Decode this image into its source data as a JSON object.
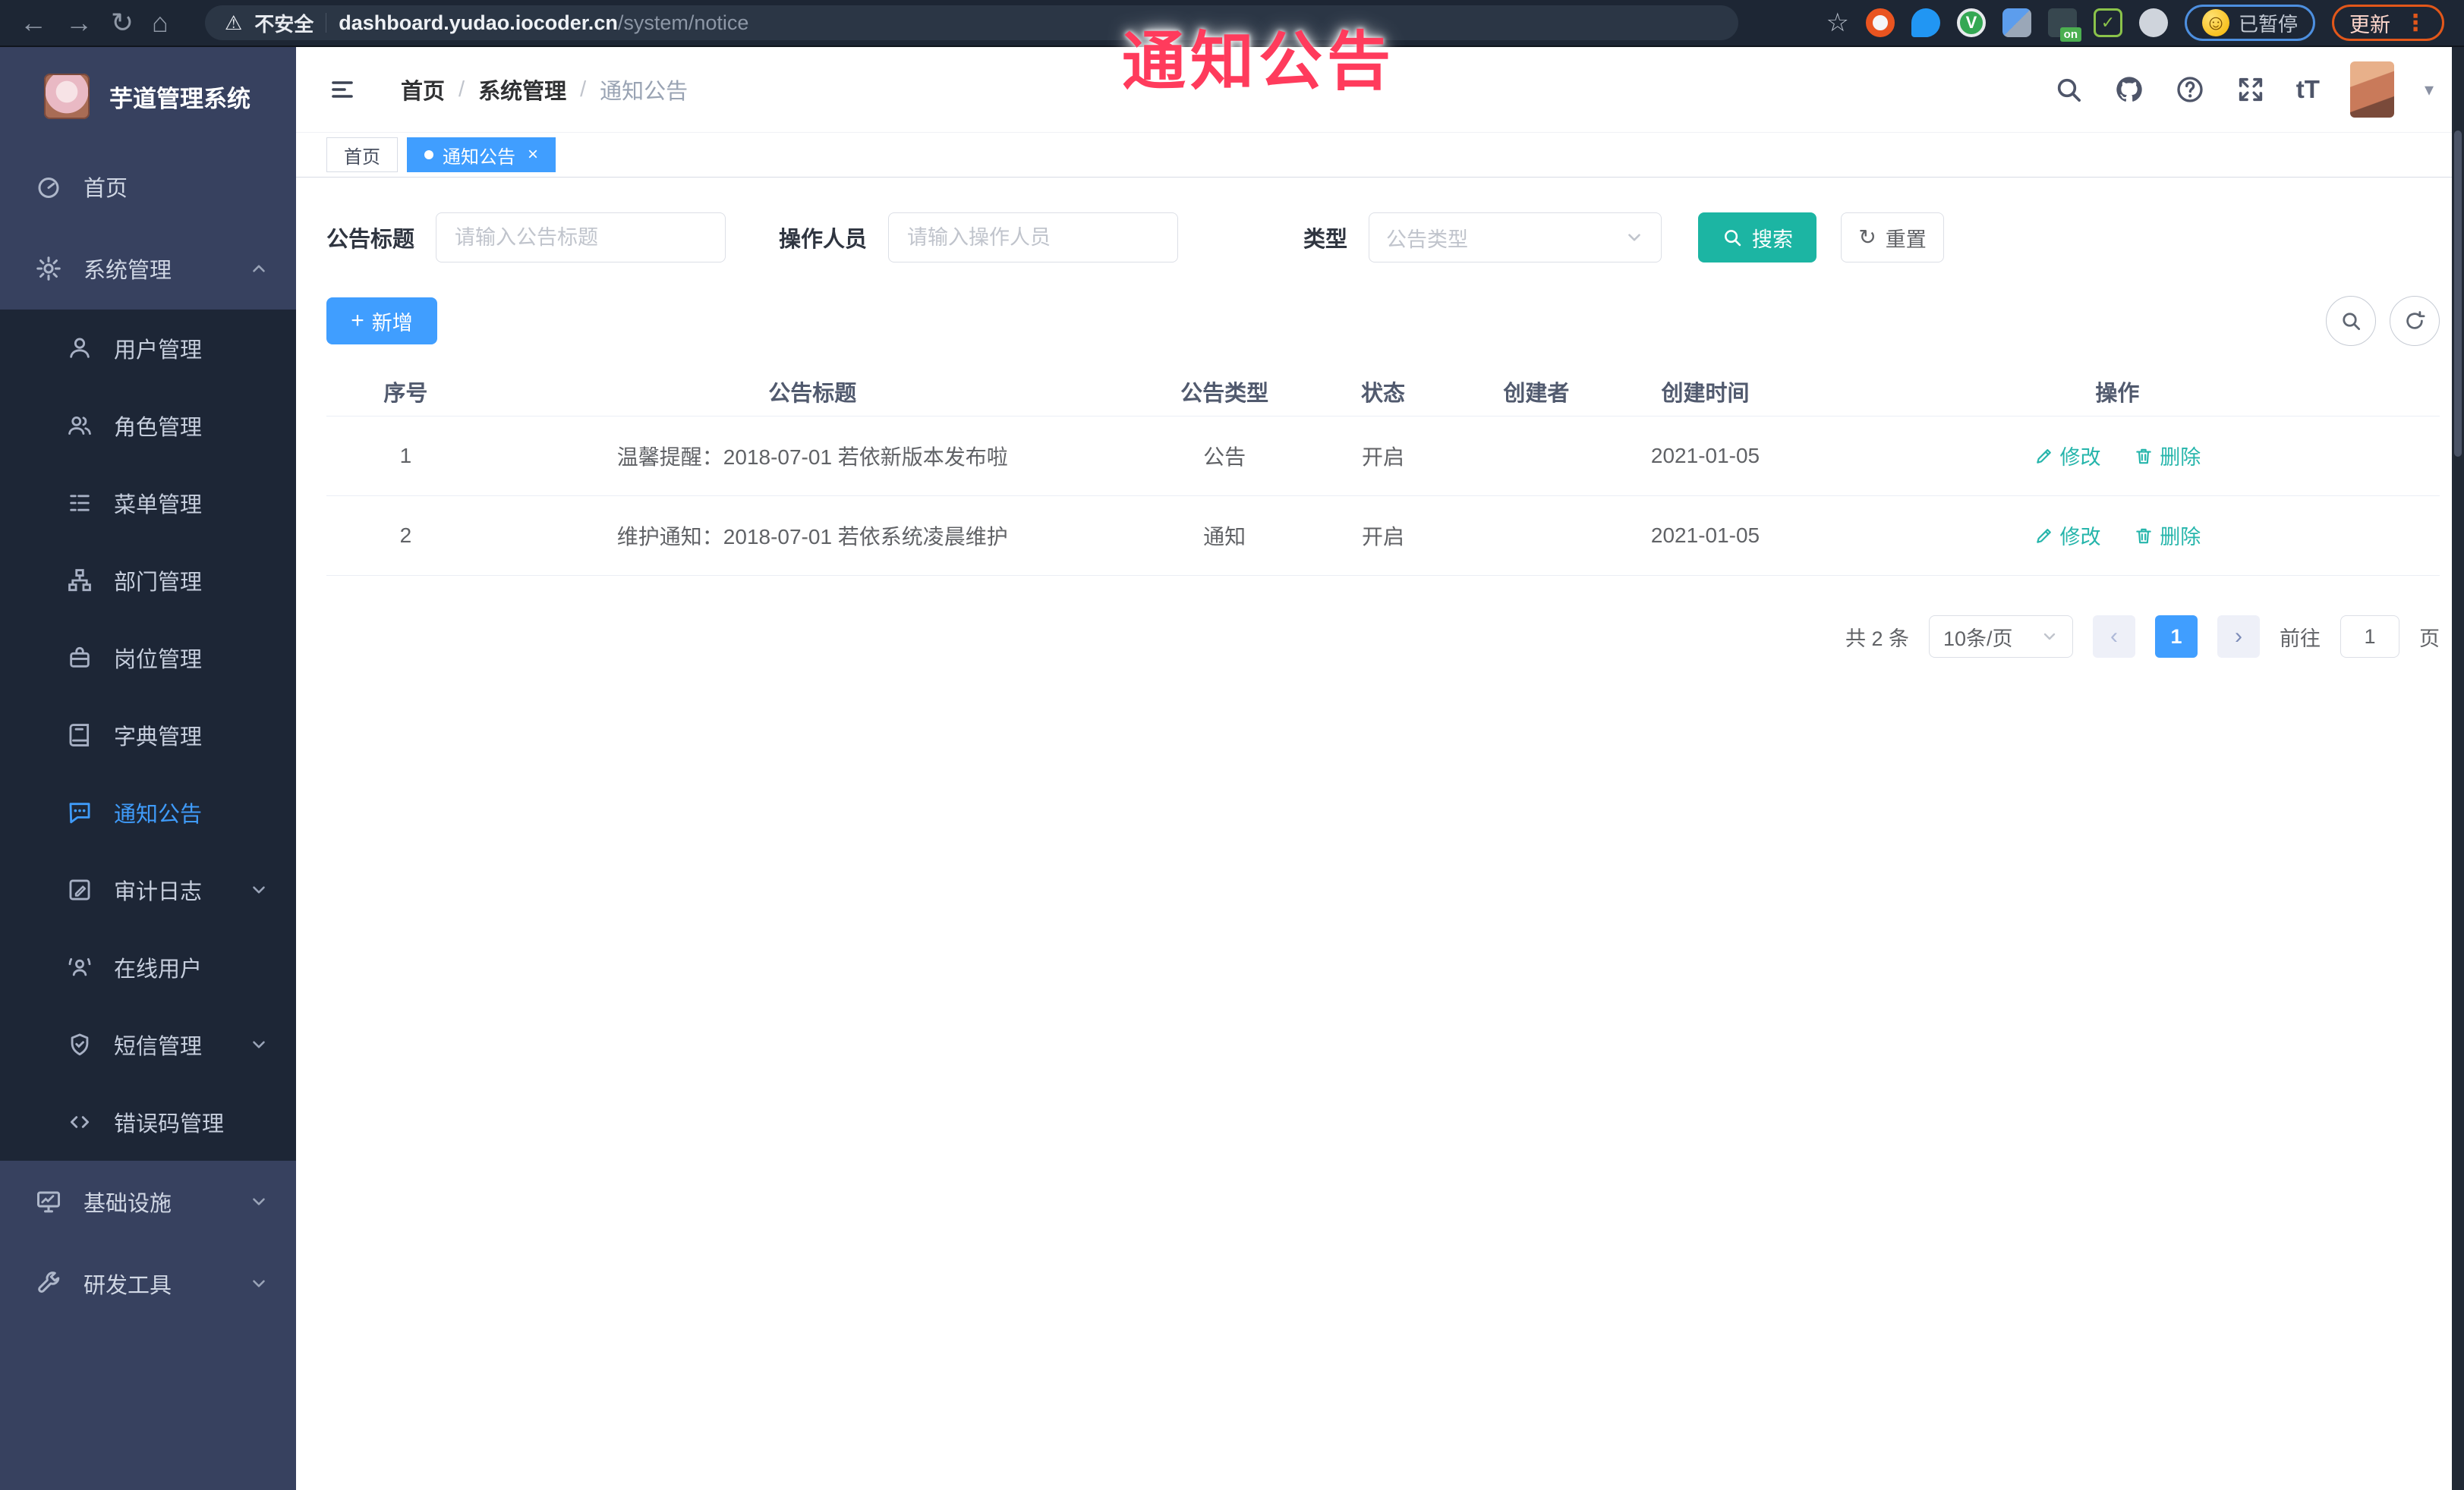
{
  "watermark": {
    "text": "通知公告",
    "color": "#ff3b5c"
  },
  "browser": {
    "security_label": "不安全",
    "url_host": "dashboard.yudao.iocoder.cn",
    "url_path": "/system/notice",
    "extension_badge": "on",
    "profile_status": "已暂停",
    "update_label": "更新",
    "nav_icons": [
      "back-arrow-icon",
      "forward-arrow-icon",
      "reload-icon",
      "home-icon"
    ],
    "extension_icons": [
      "bookmark-star-icon",
      "ubuntu-icon",
      "location-pin-icon",
      "green-v-icon",
      "gem-icon",
      "dark-extension-on-icon",
      "sprout-icon",
      "extensions-puzzle-icon"
    ]
  },
  "sidebar": {
    "app_title": "芋道管理系统",
    "items": [
      {
        "label": "首页",
        "icon": "dashboard-icon"
      },
      {
        "label": "系统管理",
        "icon": "gear-icon",
        "expanded": true
      },
      {
        "label": "用户管理",
        "icon": "user-icon"
      },
      {
        "label": "角色管理",
        "icon": "users-icon"
      },
      {
        "label": "菜单管理",
        "icon": "menu-list-icon"
      },
      {
        "label": "部门管理",
        "icon": "org-tree-icon"
      },
      {
        "label": "岗位管理",
        "icon": "briefcase-icon"
      },
      {
        "label": "字典管理",
        "icon": "book-icon"
      },
      {
        "label": "通知公告",
        "icon": "chat-bubble-icon",
        "active": true
      },
      {
        "label": "审计日志",
        "icon": "edit-square-icon",
        "collapsible": true
      },
      {
        "label": "在线用户",
        "icon": "online-user-icon"
      },
      {
        "label": "短信管理",
        "icon": "shield-check-icon",
        "collapsible": true
      },
      {
        "label": "错误码管理",
        "icon": "code-icon"
      },
      {
        "label": "基础设施",
        "icon": "monitor-chart-icon",
        "collapsible": true
      },
      {
        "label": "研发工具",
        "icon": "wrench-icon",
        "collapsible": true
      }
    ]
  },
  "header": {
    "breadcrumb": [
      "首页",
      "系统管理",
      "通知公告"
    ],
    "icons": [
      "search-icon",
      "github-icon",
      "help-icon",
      "fullscreen-icon",
      "font-size-icon",
      "avatar",
      "caret-down-icon"
    ]
  },
  "tabs": [
    {
      "label": "首页",
      "active": false
    },
    {
      "label": "通知公告",
      "active": true
    }
  ],
  "filters": {
    "title_label": "公告标题",
    "title_placeholder": "请输入公告标题",
    "operator_label": "操作人员",
    "operator_placeholder": "请输入操作人员",
    "type_label": "类型",
    "type_placeholder": "公告类型",
    "search_label": "搜索",
    "reset_label": "重置"
  },
  "toolbar": {
    "add_label": "新增"
  },
  "table": {
    "columns": [
      "序号",
      "公告标题",
      "公告类型",
      "状态",
      "创建者",
      "创建时间",
      "操作"
    ],
    "rows": [
      {
        "seq": "1",
        "title": "温馨提醒：2018-07-01 若依新版本发布啦",
        "type": "公告",
        "status": "开启",
        "creator": "",
        "created_at": "2021-01-05",
        "edit_label": "修改",
        "delete_label": "删除"
      },
      {
        "seq": "2",
        "title": "维护通知：2018-07-01 若依系统凌晨维护",
        "type": "通知",
        "status": "开启",
        "creator": "",
        "created_at": "2021-01-05",
        "edit_label": "修改",
        "delete_label": "删除"
      }
    ]
  },
  "pagination": {
    "total": "共 2 条",
    "page_size": "10条/页",
    "page": "1",
    "goto": "前往",
    "goto_value": "1",
    "unit": "页"
  },
  "colors": {
    "primary_blue": "#409eff",
    "teal_accent": "#1cb5a3",
    "action_link": "#26b5ab",
    "sidebar_bg": "#37415f",
    "submenu_bg": "#1d2636",
    "browser_bar_bg": "#1d2634",
    "watermark_red": "#ff3b5c"
  }
}
